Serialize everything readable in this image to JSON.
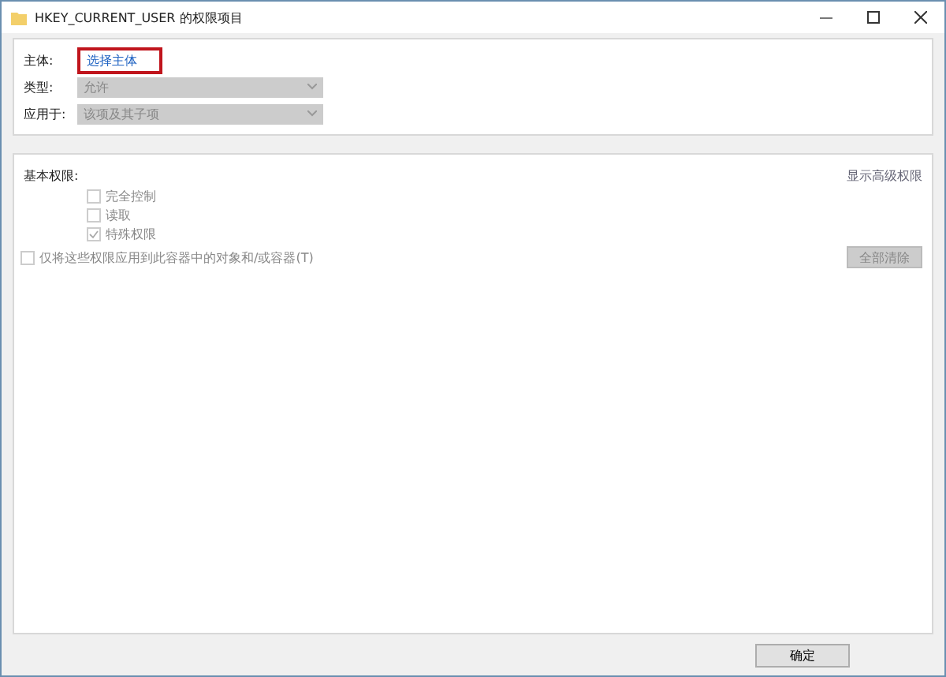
{
  "window": {
    "title": "HKEY_CURRENT_USER 的权限项目"
  },
  "principal": {
    "label": "主体:",
    "link": "选择主体",
    "highlighted": true
  },
  "fields": [
    {
      "label": "类型:",
      "value": "允许",
      "disabled": true
    },
    {
      "label": "应用于:",
      "value": "该项及其子项",
      "disabled": true
    }
  ],
  "permissions": {
    "title": "基本权限:",
    "advanced_link": "显示高级权限",
    "items": [
      {
        "label": "完全控制",
        "checked": false,
        "disabled": true
      },
      {
        "label": "读取",
        "checked": false,
        "disabled": true
      },
      {
        "label": "特殊权限",
        "checked": true,
        "disabled": true
      }
    ],
    "apply_only": {
      "label": "仅将这些权限应用到此容器中的对象和/或容器(T)",
      "checked": false,
      "disabled": true
    },
    "clear_button": {
      "label": "全部清除",
      "disabled": true
    }
  },
  "footer": {
    "buttons": [
      {
        "label": "确定"
      }
    ]
  }
}
